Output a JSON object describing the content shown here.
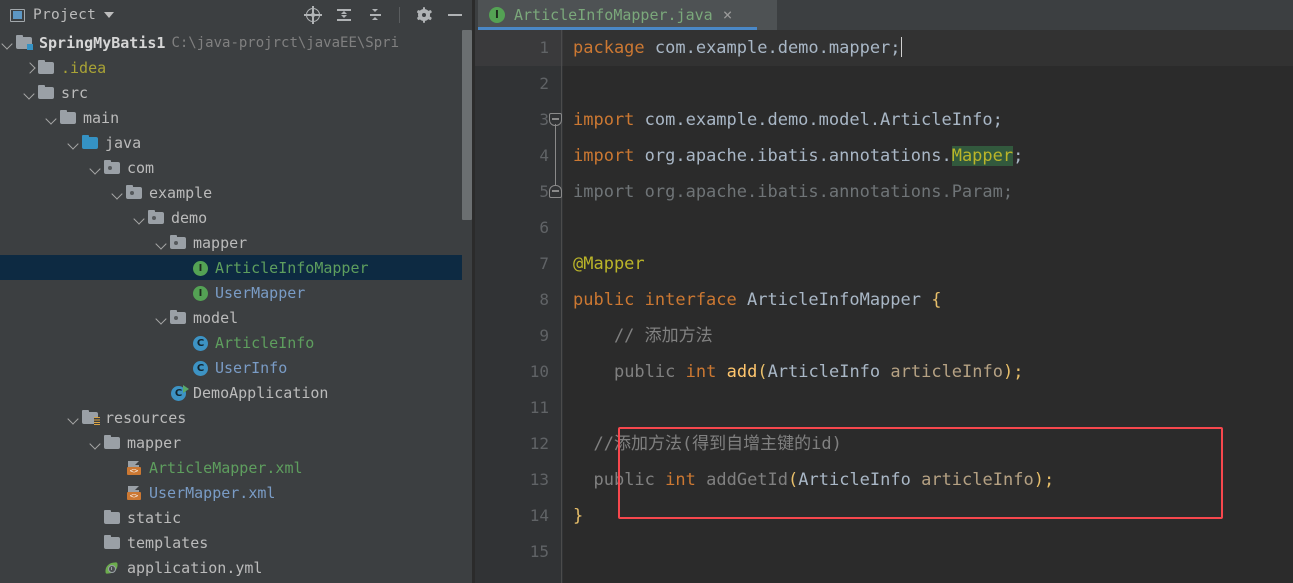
{
  "panel": {
    "title": "Project",
    "title_icon": "project-panel-icon",
    "toolbar": [
      {
        "name": "select-opened-file-icon",
        "label": "Select Opened File"
      },
      {
        "name": "expand-all-icon",
        "label": "Expand All"
      },
      {
        "name": "collapse-all-icon",
        "label": "Collapse All"
      },
      {
        "name": "settings-gear-icon",
        "label": "Settings"
      },
      {
        "name": "hide-panel-icon",
        "label": "Hide"
      }
    ],
    "tree": [
      {
        "label": "SpringMyBatis1",
        "secondary": "C:\\java-projrct\\javaEE\\Spri",
        "indent": 0,
        "arrow": "down",
        "icon": "folder-root",
        "style": "bold",
        "selected": false
      },
      {
        "label": ".idea",
        "secondary": "",
        "indent": 1,
        "arrow": "right",
        "icon": "folder",
        "style": "olive",
        "selected": false
      },
      {
        "label": "src",
        "secondary": "",
        "indent": 1,
        "arrow": "down",
        "icon": "folder",
        "style": "white",
        "selected": false
      },
      {
        "label": "main",
        "secondary": "",
        "indent": 2,
        "arrow": "down",
        "icon": "folder",
        "style": "white",
        "selected": false
      },
      {
        "label": "java",
        "secondary": "",
        "indent": 3,
        "arrow": "down",
        "icon": "folder-blue",
        "style": "white",
        "selected": false
      },
      {
        "label": "com",
        "secondary": "",
        "indent": 4,
        "arrow": "down",
        "icon": "folder-package",
        "style": "white",
        "selected": false
      },
      {
        "label": "example",
        "secondary": "",
        "indent": 5,
        "arrow": "down",
        "icon": "folder-package",
        "style": "white",
        "selected": false
      },
      {
        "label": "demo",
        "secondary": "",
        "indent": 6,
        "arrow": "down",
        "icon": "folder-package",
        "style": "white",
        "selected": false
      },
      {
        "label": "mapper",
        "secondary": "",
        "indent": 7,
        "arrow": "down",
        "icon": "folder-package",
        "style": "white",
        "selected": false
      },
      {
        "label": "ArticleInfoMapper",
        "secondary": "",
        "indent": 8,
        "arrow": "none",
        "icon": "interface-icon",
        "style": "green",
        "selected": true
      },
      {
        "label": "UserMapper",
        "secondary": "",
        "indent": 8,
        "arrow": "none",
        "icon": "interface-icon",
        "style": "blue",
        "selected": false
      },
      {
        "label": "model",
        "secondary": "",
        "indent": 7,
        "arrow": "down",
        "icon": "folder-package",
        "style": "white",
        "selected": false
      },
      {
        "label": "ArticleInfo",
        "secondary": "",
        "indent": 8,
        "arrow": "none",
        "icon": "class-icon",
        "style": "green",
        "selected": false
      },
      {
        "label": "UserInfo",
        "secondary": "",
        "indent": 8,
        "arrow": "none",
        "icon": "class-icon",
        "style": "blue",
        "selected": false
      },
      {
        "label": "DemoApplication",
        "secondary": "",
        "indent": 7,
        "arrow": "none",
        "icon": "class-runnable-icon",
        "style": "white",
        "selected": false
      },
      {
        "label": "resources",
        "secondary": "",
        "indent": 3,
        "arrow": "down",
        "icon": "folder-resources",
        "style": "white",
        "selected": false
      },
      {
        "label": "mapper",
        "secondary": "",
        "indent": 4,
        "arrow": "down",
        "icon": "folder",
        "style": "white",
        "selected": false
      },
      {
        "label": "ArticleMapper.xml",
        "secondary": "",
        "indent": 5,
        "arrow": "none",
        "icon": "xml-file-icon",
        "style": "green",
        "selected": false
      },
      {
        "label": "UserMapper.xml",
        "secondary": "",
        "indent": 5,
        "arrow": "none",
        "icon": "xml-file-icon",
        "style": "blue",
        "selected": false
      },
      {
        "label": "static",
        "secondary": "",
        "indent": 4,
        "arrow": "none",
        "icon": "folder",
        "style": "white",
        "selected": false
      },
      {
        "label": "templates",
        "secondary": "",
        "indent": 4,
        "arrow": "none",
        "icon": "folder",
        "style": "white",
        "selected": false
      },
      {
        "label": "application.yml",
        "secondary": "",
        "indent": 4,
        "arrow": "none",
        "icon": "spring-yml-icon",
        "style": "white",
        "selected": false
      }
    ]
  },
  "editor": {
    "tab": {
      "name": "ArticleInfoMapper.java",
      "icon": "interface-icon",
      "close_label": "×",
      "active_color": "#4a88c7"
    },
    "line_numbers": [
      "1",
      "2",
      "3",
      "4",
      "5",
      "6",
      "7",
      "8",
      "9",
      "10",
      "11",
      "12",
      "13",
      "14",
      "15"
    ],
    "caret_line": 1,
    "annotation_box_color": "#f7474d",
    "code": {
      "l1": [
        {
          "t": "package",
          "c": "k"
        },
        {
          "t": " com.example.demo.mapper;",
          "c": "t"
        }
      ],
      "l2": [],
      "l3": [
        {
          "t": "import",
          "c": "k"
        },
        {
          "t": " com.example.demo.model.ArticleInfo;",
          "c": "t"
        }
      ],
      "l4": [
        {
          "t": "import",
          "c": "k"
        },
        {
          "t": " org.apache.ibatis.annotations.",
          "c": "t"
        },
        {
          "t": "Mapper",
          "c": "hl"
        },
        {
          "t": ";",
          "c": "t"
        }
      ],
      "l5": [
        {
          "t": "import org.apache.ibatis.annotations.Param;",
          "c": "dim"
        }
      ],
      "l6": [],
      "l7": [
        {
          "t": "@Mapper",
          "c": "an"
        }
      ],
      "l8": [
        {
          "t": "public interface",
          "c": "k"
        },
        {
          "t": " ArticleInfoMapper ",
          "c": "t"
        },
        {
          "t": "{",
          "c": "br"
        }
      ],
      "l9": [
        {
          "t": "    // 添加方法",
          "c": "cm"
        }
      ],
      "l10": [
        {
          "t": "    ",
          "c": "t"
        },
        {
          "t": "public",
          "c": "cm"
        },
        {
          "t": " ",
          "c": "t"
        },
        {
          "t": "int",
          "c": "k"
        },
        {
          "t": " ",
          "c": "t"
        },
        {
          "t": "add",
          "c": "mth"
        },
        {
          "t": "(",
          "c": "br"
        },
        {
          "t": "ArticleInfo ",
          "c": "t"
        },
        {
          "t": "articleInfo",
          "c": "pr"
        },
        {
          "t": ")",
          "c": "br"
        },
        {
          "t": ";",
          "c": "br"
        }
      ],
      "l11": [],
      "l12": [
        {
          "t": "  //添加方法(得到自增主键的id)",
          "c": "cm"
        }
      ],
      "l13": [
        {
          "t": "  ",
          "c": "t"
        },
        {
          "t": "public",
          "c": "cm"
        },
        {
          "t": " ",
          "c": "t"
        },
        {
          "t": "int",
          "c": "k"
        },
        {
          "t": " ",
          "c": "t"
        },
        {
          "t": "addGetId",
          "c": "cm"
        },
        {
          "t": "(",
          "c": "br"
        },
        {
          "t": "ArticleInfo ",
          "c": "t"
        },
        {
          "t": "articleInfo",
          "c": "pr"
        },
        {
          "t": ")",
          "c": "br"
        },
        {
          "t": ";",
          "c": "br"
        }
      ],
      "l14": [
        {
          "t": "}",
          "c": "br"
        }
      ],
      "l15": []
    }
  }
}
